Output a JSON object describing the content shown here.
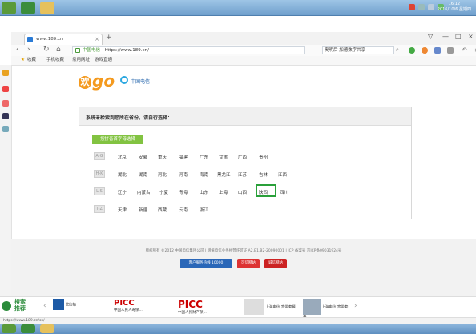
{
  "taskbar": {
    "clock_time": "16:12",
    "clock_date": "2016/10/6 星期四"
  },
  "browser": {
    "tab_title": "www.189.cn",
    "new_tab_symbol": "+",
    "address_secure_label": "中国电信",
    "address_url": "https://www.189.cn/",
    "search_placeholder": "奥明后·加德数字共享",
    "bookmarks": [
      {
        "label": "收藏"
      },
      {
        "label": "手机收藏"
      },
      {
        "label": "常用网址"
      },
      {
        "label": "游戏直通"
      }
    ]
  },
  "page": {
    "logo_letter": "欢",
    "logo_text": "go",
    "telecom_name": "中国电信",
    "panel_title": "系统未检索到您所在省份，请自行选择：",
    "pinyin_button": "按拼音首字母选择",
    "groups": [
      {
        "key": "A-G",
        "cities": [
          "北京",
          "安徽",
          "重庆",
          "福建",
          "广东",
          "甘肃",
          "广西",
          "贵州"
        ]
      },
      {
        "key": "H-K",
        "cities": [
          "湖北",
          "湖南",
          "河北",
          "河南",
          "海南",
          "黑龙江",
          "江苏",
          "吉林",
          "江西"
        ]
      },
      {
        "key": "L-S",
        "cities": [
          "辽宁",
          "内蒙古",
          "宁夏",
          "青海",
          "山东",
          "上海",
          "山西",
          "陕西",
          "四川"
        ]
      },
      {
        "key": "T-Z",
        "cities": [
          "天津",
          "新疆",
          "西藏",
          "云南",
          "浙江"
        ]
      }
    ],
    "highlighted_city": "陕西",
    "footer_copyright": "版权所有 ©2012 中国电信集团公司 | 增值电信业务经营许可证 A2.B1.B2-20090001 | ICP 备案号 京ICP备09031924号",
    "footer_badges": [
      "客户服务热线 10000",
      "可信网站",
      "诚信网站"
    ]
  },
  "adbar": {
    "search_label_1": "搜索",
    "search_label_2": "推荐",
    "ads": [
      {
        "label": "优信拍"
      },
      {
        "label": "PICC",
        "sub": "中国人民人寿保..."
      },
      {
        "label": "PICC",
        "sub": "中国人民财产保..."
      },
      {
        "label": "上海电信",
        "sub": "宽带套餐"
      },
      {
        "label": "上海电信",
        "sub": "宽带套餐"
      }
    ]
  },
  "statusbar": {
    "url": "https://www.189.cn/sx/"
  },
  "colors": {
    "accent_green": "#82c341",
    "highlight_green": "#2aa03a",
    "logo_orange": "#f49a1f",
    "telecom_blue": "#2aa7e0"
  }
}
